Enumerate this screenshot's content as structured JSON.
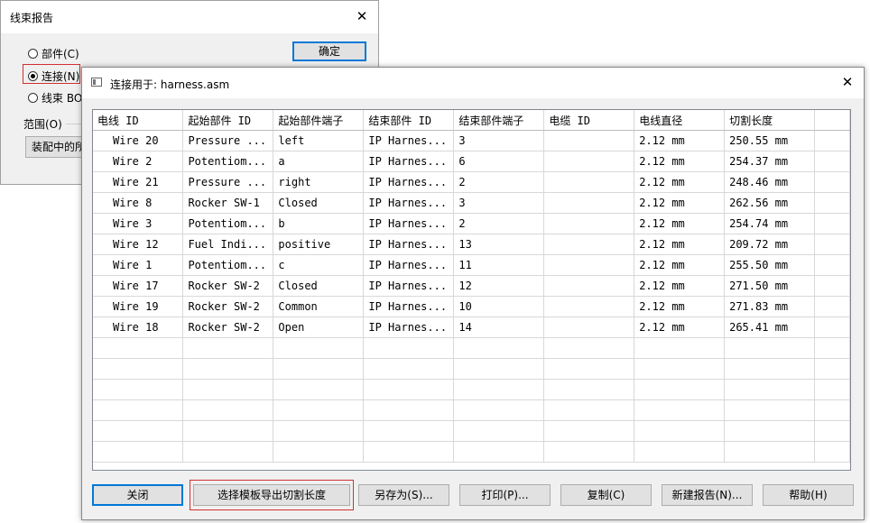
{
  "bg_dialog": {
    "title": "线束报告",
    "close_glyph": "✕",
    "radio_options": [
      {
        "label": "部件(C)",
        "checked": false
      },
      {
        "label": "连接(N)",
        "checked": true
      },
      {
        "label": "线束 BO",
        "checked": false
      }
    ],
    "ok_label": "确定",
    "range_label": "范围(O)",
    "scope_button_label": "装配中的所"
  },
  "main_dialog": {
    "title": "连接用于: harness.asm",
    "close_glyph": "✕",
    "columns": [
      "电线 ID",
      "起始部件 ID",
      "起始部件端子",
      "结束部件 ID",
      "结束部件端子",
      "电缆 ID",
      "电线直径",
      "切割长度"
    ],
    "rows": [
      [
        "Wire 20",
        "Pressure ...",
        "left",
        "IP Harnes...",
        "3",
        "",
        "2.12 mm",
        "250.55 mm"
      ],
      [
        "Wire 2",
        "Potentiom...",
        "a",
        "IP Harnes...",
        "6",
        "",
        "2.12 mm",
        "254.37 mm"
      ],
      [
        "Wire 21",
        "Pressure ...",
        "right",
        "IP Harnes...",
        "2",
        "",
        "2.12 mm",
        "248.46 mm"
      ],
      [
        "Wire 8",
        "Rocker SW-1",
        "Closed",
        "IP Harnes...",
        "3",
        "",
        "2.12 mm",
        "262.56 mm"
      ],
      [
        "Wire 3",
        "Potentiom...",
        "b",
        "IP Harnes...",
        "2",
        "",
        "2.12 mm",
        "254.74 mm"
      ],
      [
        "Wire 12",
        "Fuel Indi...",
        "positive",
        "IP Harnes...",
        "13",
        "",
        "2.12 mm",
        "209.72 mm"
      ],
      [
        "Wire 1",
        "Potentiom...",
        "c",
        "IP Harnes...",
        "11",
        "",
        "2.12 mm",
        "255.50 mm"
      ],
      [
        "Wire 17",
        "Rocker SW-2",
        "Closed",
        "IP Harnes...",
        "12",
        "",
        "2.12 mm",
        "271.50 mm"
      ],
      [
        "Wire 19",
        "Rocker SW-2",
        "Common",
        "IP Harnes...",
        "10",
        "",
        "2.12 mm",
        "271.83 mm"
      ],
      [
        "Wire 18",
        "Rocker SW-2",
        "Open",
        "IP Harnes...",
        "14",
        "",
        "2.12 mm",
        "265.41 mm"
      ]
    ],
    "buttons": {
      "close": "关闭",
      "export_cut_length": "选择模板导出切割长度",
      "save_as": "另存为(S)...",
      "print": "打印(P)...",
      "copy": "复制(C)",
      "new_report": "新建报告(N)...",
      "help": "帮助(H)"
    }
  },
  "colors": {
    "highlight": "#d32f2f",
    "focus_border": "#0078d7"
  }
}
